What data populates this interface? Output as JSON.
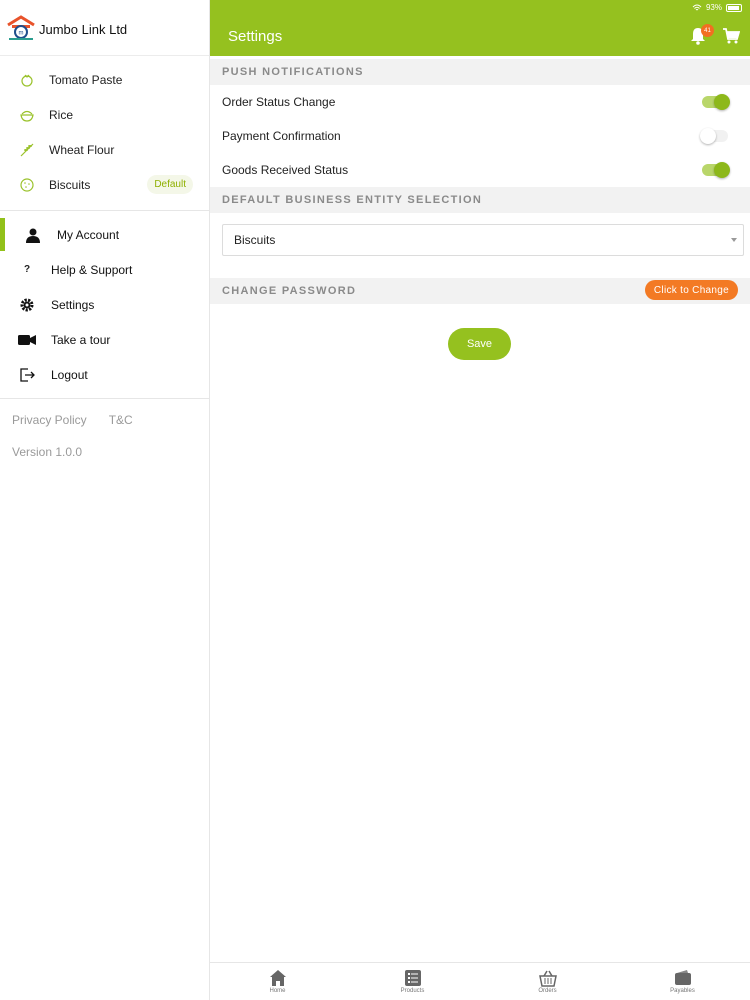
{
  "brand": {
    "name": "Jumbo Link Ltd",
    "logo": "jumbo-link-logo"
  },
  "entities": [
    {
      "label": "Tomato Paste",
      "icon": "tomato-icon"
    },
    {
      "label": "Rice",
      "icon": "rice-bowl-icon"
    },
    {
      "label": "Wheat Flour",
      "icon": "wheat-icon"
    },
    {
      "label": "Biscuits",
      "icon": "biscuit-icon",
      "badge": "Default"
    }
  ],
  "menu": [
    {
      "label": "My Account",
      "icon": "user-icon",
      "active": true
    },
    {
      "label": "Help & Support",
      "icon": "question-icon"
    },
    {
      "label": "Settings",
      "icon": "gear-icon"
    },
    {
      "label": "Take a tour",
      "icon": "video-camera-icon"
    },
    {
      "label": "Logout",
      "icon": "logout-icon"
    }
  ],
  "footer": {
    "privacy": "Privacy Policy",
    "terms": "T&C",
    "version": "Version 1.0.0"
  },
  "status_bar": {
    "battery": "93%"
  },
  "topbar": {
    "title": "Settings",
    "notification_count": "41"
  },
  "push_notifications": {
    "heading": "PUSH NOTIFICATIONS",
    "items": [
      {
        "label": "Order Status Change",
        "enabled": true
      },
      {
        "label": "Payment Confirmation",
        "enabled": false
      },
      {
        "label": "Goods Received Status",
        "enabled": true
      }
    ]
  },
  "default_entity": {
    "heading": "DEFAULT BUSINESS ENTITY SELECTION",
    "selected": "Biscuits"
  },
  "change_password": {
    "heading": "CHANGE PASSWORD",
    "button": "Click to Change"
  },
  "save_label": "Save",
  "tabs": [
    {
      "label": "Home",
      "icon": "home-icon"
    },
    {
      "label": "Products",
      "icon": "list-icon"
    },
    {
      "label": "Orders",
      "icon": "basket-icon"
    },
    {
      "label": "Payables",
      "icon": "wallet-icon"
    }
  ],
  "colors": {
    "accent": "#95c11f",
    "orange": "#f37a24"
  }
}
